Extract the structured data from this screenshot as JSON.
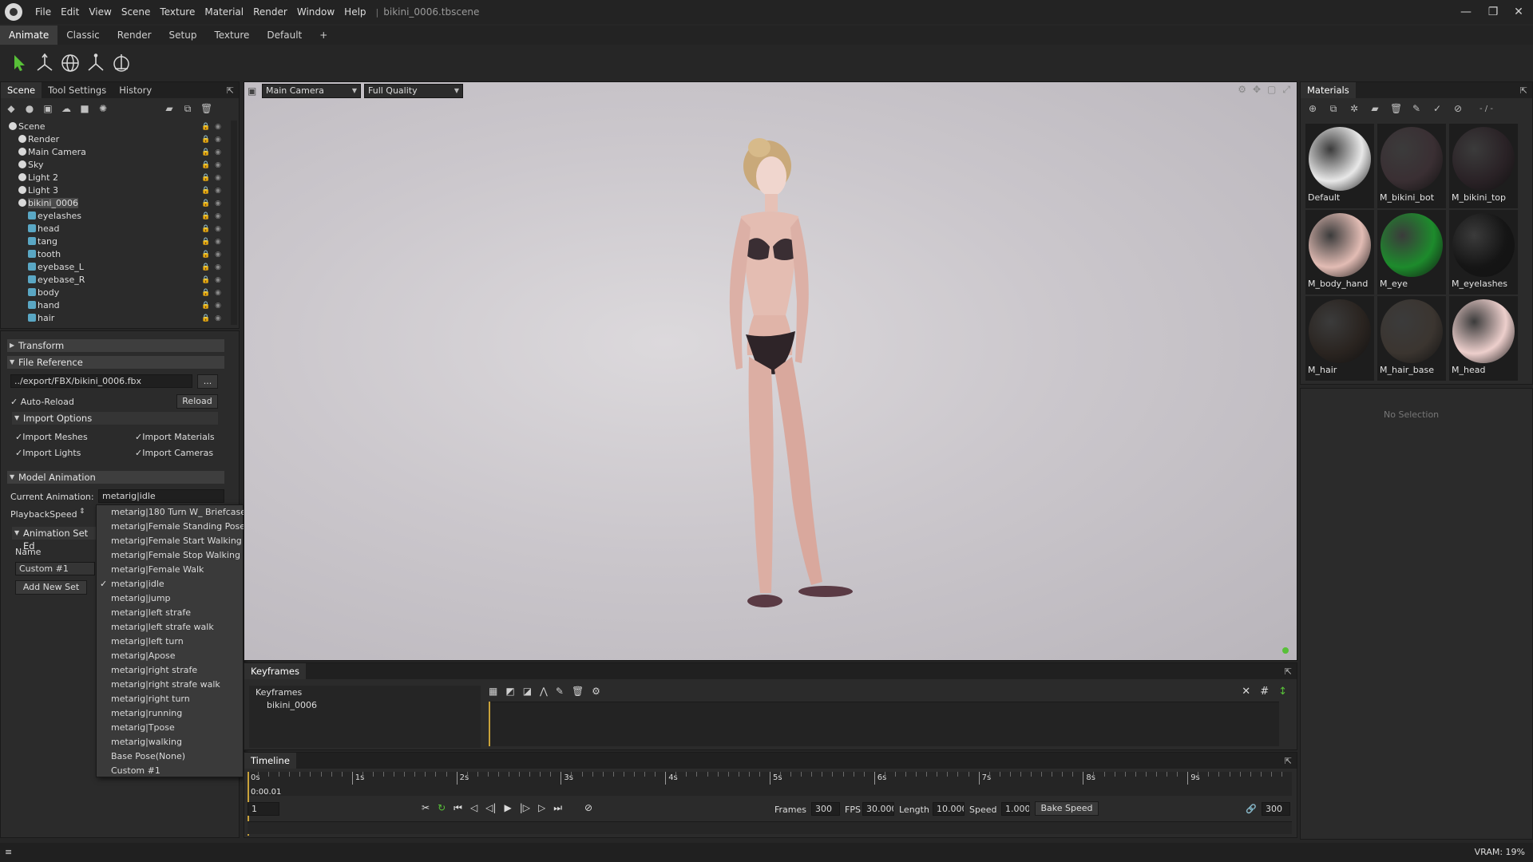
{
  "titlebar": {
    "menu": [
      "File",
      "Edit",
      "View",
      "Scene",
      "Texture",
      "Material",
      "Render",
      "Window",
      "Help"
    ],
    "scene_file": "bikini_0006.tbscene",
    "minimize_icon": "minimize-icon",
    "maximize_icon": "restore-icon",
    "close_icon": "close-icon"
  },
  "layout_tabs": [
    "Animate",
    "Classic",
    "Render",
    "Setup",
    "Texture",
    "Default",
    "+"
  ],
  "toolbar": {
    "tools": [
      "select-icon",
      "transform-icon",
      "rotate-icon",
      "axis-icon",
      "scale-icon"
    ]
  },
  "left_panel": {
    "tabs": [
      "Scene",
      "Tool Settings",
      "History"
    ],
    "tree": [
      {
        "label": "Scene",
        "indent": 0,
        "icon": "scene-icon"
      },
      {
        "label": "Render",
        "indent": 1,
        "icon": "render-icon"
      },
      {
        "label": "Main Camera",
        "indent": 1,
        "icon": "camera-icon"
      },
      {
        "label": "Sky",
        "indent": 1,
        "icon": "sky-icon"
      },
      {
        "label": "Light 2",
        "indent": 1,
        "icon": "light-icon"
      },
      {
        "label": "Light 3",
        "indent": 1,
        "icon": "light-icon"
      },
      {
        "label": "bikini_0006",
        "indent": 1,
        "icon": "model-icon",
        "selected": true
      },
      {
        "label": "eyelashes",
        "indent": 2,
        "icon": "mesh-icon"
      },
      {
        "label": "head",
        "indent": 2,
        "icon": "mesh-icon"
      },
      {
        "label": "tang",
        "indent": 2,
        "icon": "mesh-icon"
      },
      {
        "label": "tooth",
        "indent": 2,
        "icon": "mesh-icon"
      },
      {
        "label": "eyebase_L",
        "indent": 2,
        "icon": "mesh-icon"
      },
      {
        "label": "eyebase_R",
        "indent": 2,
        "icon": "mesh-icon"
      },
      {
        "label": "body",
        "indent": 2,
        "icon": "mesh-icon"
      },
      {
        "label": "hand",
        "indent": 2,
        "icon": "mesh-icon"
      },
      {
        "label": "hair",
        "indent": 2,
        "icon": "mesh-icon"
      }
    ],
    "sections": {
      "transform": "Transform",
      "file_reference": "File Reference",
      "file_path": "../export/FBX/bikini_0006.fbx",
      "browse_label": "...",
      "auto_reload": "Auto-Reload",
      "reload_button": "Reload",
      "import_options": "Import Options",
      "import_meshes": "Import Meshes",
      "import_materials": "Import Materials",
      "import_lights": "Import Lights",
      "import_cameras": "Import Cameras",
      "model_animation": "Model Animation",
      "current_animation_label": "Current Animation:",
      "current_animation_value": "metarig|idle",
      "playback_speed_label": "PlaybackSpeed",
      "animation_set_editor": "Animation Set Ed",
      "name_label": "Name",
      "custom_name": "Custom #1",
      "add_new_set": "Add New Set"
    }
  },
  "animation_dropdown": {
    "items": [
      "metarig|180 Turn W_ Briefcase",
      "metarig|Female Standing Pose",
      "metarig|Female Start Walking",
      "metarig|Female Stop Walking",
      "metarig|Female Walk",
      "metarig|idle",
      "metarig|jump",
      "metarig|left strafe",
      "metarig|left strafe walk",
      "metarig|left turn",
      "metarig|Apose",
      "metarig|right strafe",
      "metarig|right strafe walk",
      "metarig|right turn",
      "metarig|running",
      "metarig|Tpose",
      "metarig|walking",
      "Base Pose(None)",
      "Custom #1"
    ],
    "checked": "metarig|idle"
  },
  "viewport": {
    "camera": "Main Camera",
    "quality": "Full Quality",
    "icons": [
      "settings-icon",
      "move-icon",
      "frame-icon",
      "expand-icon"
    ]
  },
  "materials_panel": {
    "title": "Materials",
    "counter": "- / -",
    "no_selection": "No Selection",
    "items": [
      {
        "name": "Default",
        "swatch": "#e8e8e8"
      },
      {
        "name": "M_bikini_bot",
        "swatch": "#3a2f33"
      },
      {
        "name": "M_bikini_top",
        "swatch": "#2a2226"
      },
      {
        "name": "M_body_hand",
        "swatch": "#e2bcb4"
      },
      {
        "name": "M_eye",
        "swatch": "#1d8b2c"
      },
      {
        "name": "M_eyelashes",
        "swatch": "#151515"
      },
      {
        "name": "M_hair",
        "swatch": "#2a2420"
      },
      {
        "name": "M_hair_base",
        "swatch": "#3b3530"
      },
      {
        "name": "M_head",
        "swatch": "#edcfcc"
      }
    ]
  },
  "keyframes": {
    "title": "Keyframes",
    "tree": [
      "Keyframes",
      "bikini_0006"
    ]
  },
  "timeline": {
    "title": "Timeline",
    "ticks": [
      "0s",
      "1s",
      "2s",
      "3s",
      "4s",
      "5s",
      "6s",
      "7s",
      "8s",
      "9s"
    ],
    "current_time": "0:00.01",
    "frame_field": "1",
    "frames_label": "Frames",
    "frames_value": "300",
    "fps_label": "FPS",
    "fps_value": "30.000",
    "length_label": "Length",
    "length_value": "10.000",
    "speed_label": "Speed",
    "speed_value": "1.000",
    "bake_speed": "Bake Speed",
    "end_frame": "300",
    "playhead_fraction": 0.0
  },
  "statusbar": {
    "vram": "VRAM: 19%"
  },
  "colors": {
    "accent_green": "#58c038",
    "selection": "#4a4a4a",
    "panel_bg": "#2b2b2b",
    "viewport_bg": "#cbc7cc"
  }
}
